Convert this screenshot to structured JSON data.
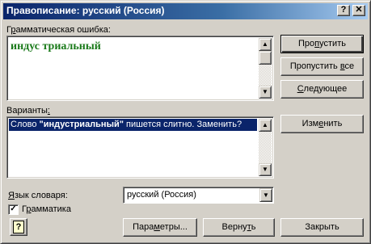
{
  "window": {
    "title": "Правописание: русский (Россия)",
    "help_glyph": "?",
    "close_glyph": "✕"
  },
  "grammar": {
    "label_pre": "Г",
    "label_ul": "р",
    "label_post": "амматическая ошибка:",
    "error_text": "индус триальный"
  },
  "variants": {
    "label_pre": "Варианты",
    "label_ul": ":",
    "label_post": "",
    "suggestion_pre": "Слово ",
    "suggestion_word": "\"индустриальный\"",
    "suggestion_post": " пишется слитно. Заменить?"
  },
  "buttons": {
    "skip": {
      "pre": "Про",
      "ul": "п",
      "post": "устить"
    },
    "skip_all": {
      "pre": "Пропустить ",
      "ul": "в",
      "post": "се"
    },
    "next": {
      "pre": "",
      "ul": "С",
      "post": "ледующее"
    },
    "change": {
      "pre": "Изм",
      "ul": "е",
      "post": "нить"
    },
    "options": {
      "pre": "Пара",
      "ul": "м",
      "post": "етры..."
    },
    "undo": {
      "pre": "Верну",
      "ul": "т",
      "post": "ь"
    },
    "close": {
      "pre": "Закрыть",
      "ul": "",
      "post": ""
    }
  },
  "dictionary": {
    "label_pre": "",
    "label_ul": "Я",
    "label_post": "зык словаря:",
    "value": "русский (Россия)"
  },
  "grammar_check": {
    "checked": true,
    "check_glyph": "✓",
    "label_pre": "Г",
    "label_ul": "р",
    "label_post": "амматика"
  },
  "help_button": {
    "glyph": "?"
  },
  "scroll_glyphs": {
    "up": "▲",
    "down": "▼"
  }
}
